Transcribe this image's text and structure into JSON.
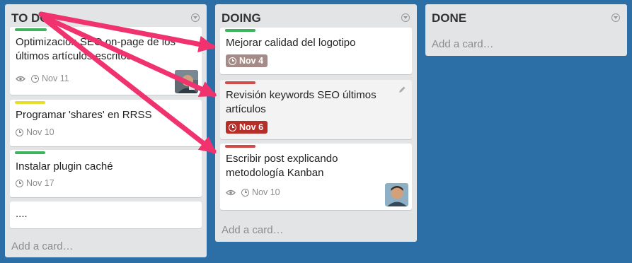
{
  "colors": {
    "board_bg": "#2b6fa6",
    "label_green": "#3fb25d",
    "label_yellow": "#e6df2a",
    "label_red": "#d24b4b",
    "due_past": "#a58b87",
    "due_overdue": "#b52f28",
    "arrow": "#f0326e"
  },
  "lists": {
    "todo": {
      "title": "TO DO",
      "add_card": "Add a card…",
      "cards": [
        {
          "title": "Optimización SEO on-page de los últimos artículos escritos",
          "label": "green",
          "has_watch": true,
          "due": "Nov 11",
          "has_avatar": true
        },
        {
          "title": "Programar 'shares' en RRSS",
          "label": "yellow",
          "due": "Nov 10"
        },
        {
          "title": "Instalar plugin caché",
          "label": "green",
          "due": "Nov 17"
        },
        {
          "title": "...."
        }
      ]
    },
    "doing": {
      "title": "DOING",
      "add_card": "Add a card…",
      "cards": [
        {
          "title": "Mejorar calidad del logotipo",
          "label": "green",
          "due": "Nov 4",
          "due_style": "past"
        },
        {
          "title": "Revisión keywords SEO últimos artículos",
          "label": "red",
          "due": "Nov 6",
          "due_style": "overdue",
          "edit_icon": "pencil-icon"
        },
        {
          "title": "Escribir post explicando metodología Kanban",
          "label": "red",
          "has_watch": true,
          "due": "Nov 10",
          "has_avatar": true
        }
      ]
    },
    "done": {
      "title": "DONE",
      "add_card": "Add a card…",
      "cards": []
    }
  },
  "icons": {
    "list_menu": "chevron-circle-icon",
    "watch": "eye-icon",
    "due": "clock-icon",
    "edit": "pencil-icon"
  }
}
